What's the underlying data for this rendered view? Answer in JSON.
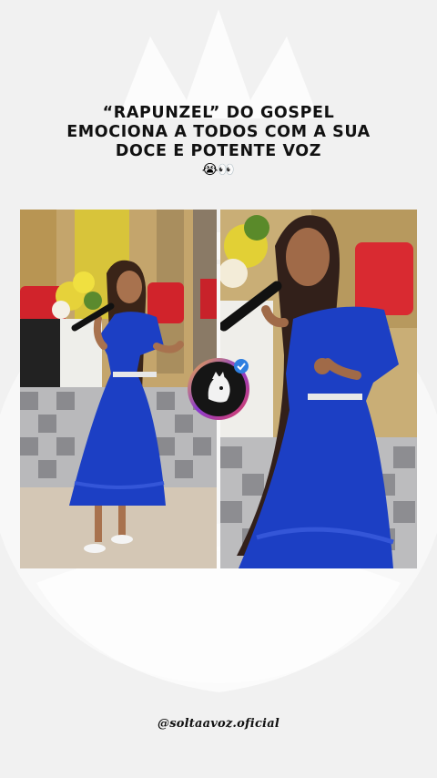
{
  "headline": {
    "line1": "“RAPUNZEL” DO GOSPEL",
    "line2": "EMOCIONA A TODOS COM A SUA",
    "line3": "DOCE E POTENTE VOZ",
    "emojis": "😭👀"
  },
  "handle": "@soltaavoz.oficial",
  "colors": {
    "background": "#f1f1f1",
    "dress": "#1c3fc4",
    "badge_ring": "#2f7fe0"
  },
  "icons": {
    "badge": "lion-icon",
    "verified": "check-icon"
  }
}
